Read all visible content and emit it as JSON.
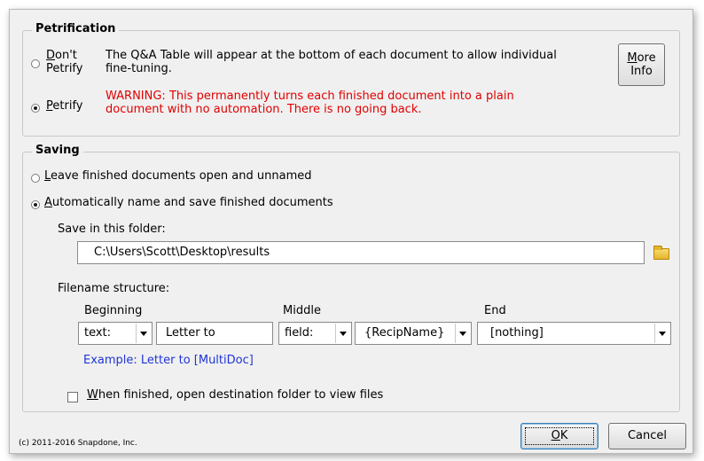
{
  "petrification": {
    "legend": "Petrification",
    "dont_petrify_label_line1": "Don't",
    "dont_petrify_label_line2": "Petrify",
    "dont_petrify_desc_line1": "The Q&A Table will appear at the bottom of each document to allow individual",
    "dont_petrify_desc_line2": "fine-tuning.",
    "petrify_label": "Petrify",
    "petrify_warning_line1": "WARNING:  This permanently turns each finished document into a plain",
    "petrify_warning_line2": "document with no automation.  There is no going back.",
    "more_info_line1": "More",
    "more_info_line2": "Info",
    "selected": "petrify"
  },
  "saving": {
    "legend": "Saving",
    "leave_open_label": "Leave finished documents open and unnamed",
    "auto_name_label": "Automatically name and save finished documents",
    "selected": "auto_name",
    "folder_label": "Save in this folder:",
    "folder_path": "C:\\Users\\Scott\\Desktop\\results",
    "filename_label": "Filename structure:",
    "beginning_label": "Beginning",
    "middle_label": "Middle",
    "end_label": "End",
    "beginning_type": "text:",
    "beginning_value": "Letter to",
    "middle_type": "field:",
    "middle_value": "{RecipName}",
    "end_value": "[nothing]",
    "example": "Example:  Letter to [MultiDoc]",
    "open_folder_label": "When finished, open destination folder to view files",
    "open_folder_checked": false
  },
  "footer": {
    "copyright": "(c) 2011-2016 Snapdone, Inc.",
    "ok_label": "OK",
    "cancel_label": "Cancel"
  },
  "colors": {
    "warning": "#e00000",
    "example": "#1f35d6"
  }
}
